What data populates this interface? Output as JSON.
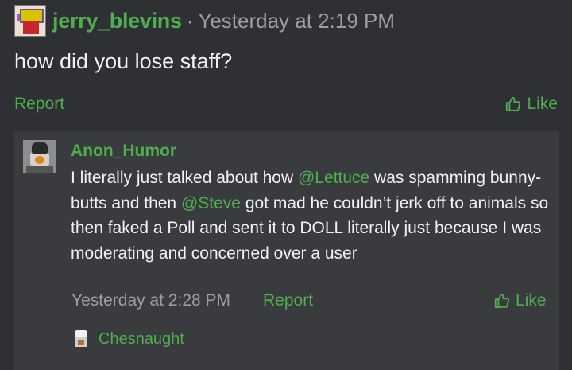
{
  "post": {
    "author": "jerry_blevins",
    "separator": "·",
    "timestamp": "Yesterday at 2:19 PM",
    "message": "how did you lose staff?",
    "report_label": "Report",
    "like_label": "Like"
  },
  "reply": {
    "author": "Anon_Humor",
    "text_1": "I literally just talked about how ",
    "mention_1": "@Lettuce",
    "text_2": " was spamming bunny-butts and then ",
    "mention_2": "@Steve",
    "text_3": " got mad he couldn’t jerk off to animals so then faked a Poll and sent it to DOLL literally just because I was moderating and concerned over a user",
    "timestamp": "Yesterday at 2:28 PM",
    "report_label": "Report",
    "like_label": "Like",
    "liked_by": "Chesnaught"
  },
  "colors": {
    "background": "#2f3033",
    "quote_background": "#3a3b3e",
    "accent_green": "#4fae4e",
    "muted_text": "#9b9ea2",
    "text": "#f2f2f2"
  },
  "icons": {
    "like": "thumbs-up-icon"
  }
}
